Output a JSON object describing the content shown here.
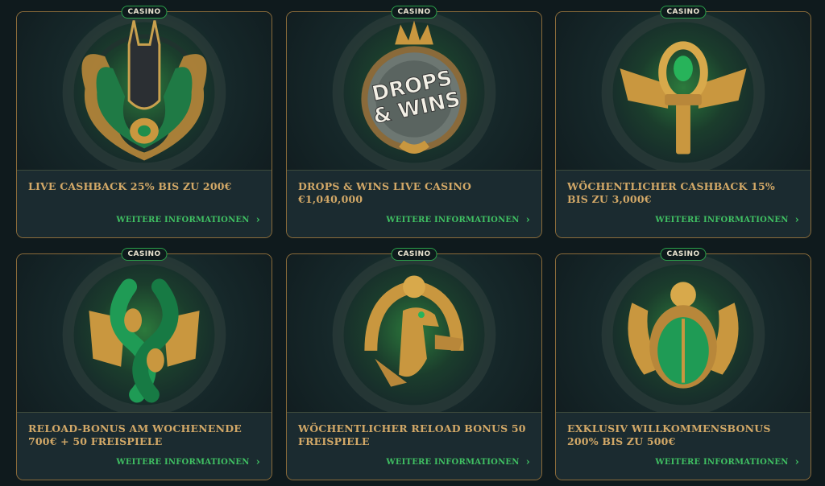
{
  "cards": [
    {
      "badge": "CASINO",
      "title": "LIVE CASHBACK 25% BIS ZU 200€",
      "link": "WEITERE INFORMATIONEN",
      "icon": "anubis-emblem-icon"
    },
    {
      "badge": "CASINO",
      "title": "DROPS & WINS LIVE CASINO €1,040,000",
      "link": "WEITERE INFORMATIONEN",
      "icon": "drops-and-wins-medallion-icon",
      "art_text": [
        "DROPS",
        "& WINS"
      ]
    },
    {
      "badge": "CASINO",
      "title": "WÖCHENTLICHER CASHBACK 15% BIS ZU 3,000€",
      "link": "WEITERE INFORMATIONEN",
      "icon": "winged-ankh-icon"
    },
    {
      "badge": "CASINO",
      "title": "RELOAD-BONUS AM WOCHENENDE 700€ + 50 FREISPIELE",
      "link": "WEITERE INFORMATIONEN",
      "icon": "twin-serpent-icon"
    },
    {
      "badge": "CASINO",
      "title": "WÖCHENTLICHER RELOAD BONUS 50 FREISPIELE",
      "link": "WEITERE INFORMATIONEN",
      "icon": "horus-falcon-icon"
    },
    {
      "badge": "CASINO",
      "title": "EXKLUSIV WILLKOMMENSBONUS 200% BIS ZU 500€",
      "link": "WEITERE INFORMATIONEN",
      "icon": "scarab-emblem-icon"
    }
  ],
  "colors": {
    "gold": "#d2a867",
    "green": "#3fbf62",
    "border": "#8a6b3a",
    "badge_border": "#2aa14b"
  }
}
